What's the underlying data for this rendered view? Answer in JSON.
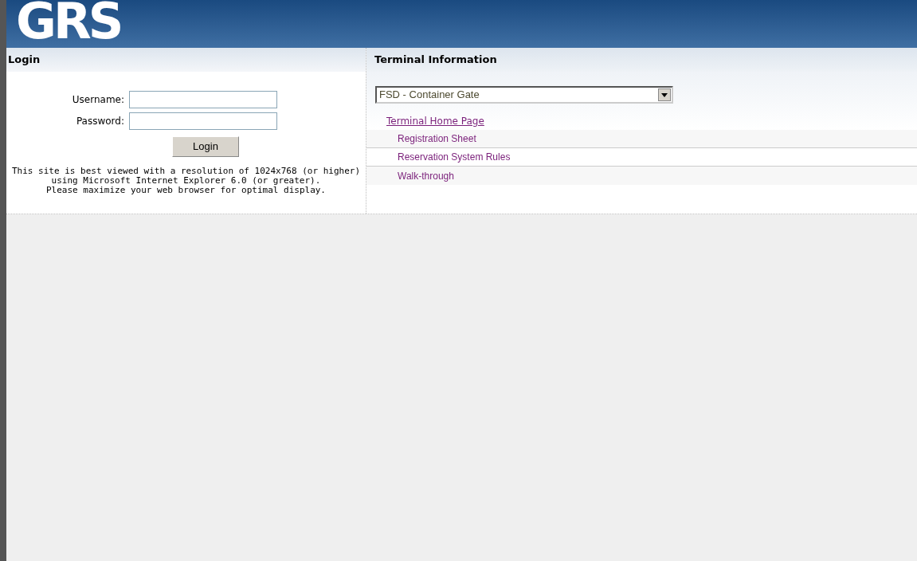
{
  "header": {
    "logo": "GRS"
  },
  "login": {
    "title": "Login",
    "fields": [
      {
        "label": "Username:"
      },
      {
        "label": "Password:"
      }
    ],
    "button": "Login",
    "notes": [
      "This site is best viewed with a resolution of 1024x768 (or higher)",
      "using Microsoft Internet Explorer 6.0 (or greater).",
      "Please maximize your web browser for optimal display."
    ]
  },
  "terminal": {
    "title": "Terminal Information",
    "select": {
      "value": "FSD - Container Gate"
    },
    "home_link": "Terminal Home Page",
    "links": [
      {
        "label": "Registration Sheet"
      },
      {
        "label": "Reservation System Rules"
      },
      {
        "label": "Walk-through"
      }
    ]
  }
}
